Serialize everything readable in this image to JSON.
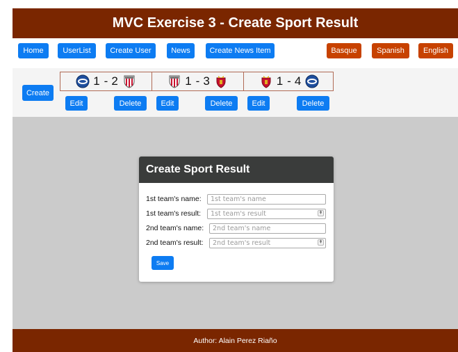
{
  "header": {
    "title": "MVC Exercise 3 - Create Sport Result"
  },
  "nav": {
    "left": [
      {
        "label": "Home"
      },
      {
        "label": "UserList"
      },
      {
        "label": "Create User"
      },
      {
        "label": "News"
      },
      {
        "label": "Create News Item"
      }
    ],
    "languages": [
      {
        "label": "Basque"
      },
      {
        "label": "Spanish"
      },
      {
        "label": "English"
      }
    ]
  },
  "results": {
    "create_label": "Create",
    "edit_label": "Edit",
    "delete_label": "Delete",
    "items": [
      {
        "team1_icon": "blue-crest-icon",
        "team1_result": "1",
        "separator": "-",
        "team2_result": "2",
        "team2_icon": "striped-crest-icon"
      },
      {
        "team1_icon": "striped-crest-icon",
        "team1_result": "1",
        "separator": "-",
        "team2_result": "3",
        "team2_icon": "red-crest-icon"
      },
      {
        "team1_icon": "red-crest-icon",
        "team1_result": "1",
        "separator": "-",
        "team2_result": "4",
        "team2_icon": "blue-crest-icon"
      }
    ]
  },
  "form": {
    "title": "Create Sport Result",
    "fields": [
      {
        "label": "1st team's name:",
        "placeholder": "1st team's name"
      },
      {
        "label": "1st team's result:",
        "placeholder": "1st team's result"
      },
      {
        "label": "2nd team's name:",
        "placeholder": "2nd team's name"
      },
      {
        "label": "2nd team's result:",
        "placeholder": "2nd team's result"
      }
    ],
    "save_label": "Save"
  },
  "footer": {
    "text": "Author: Alain Perez Riaño"
  },
  "colors": {
    "header_bg": "#7a2600",
    "nav_button": "#0d7cf2",
    "language_button": "#c74200",
    "card_header": "#3a3c3b",
    "page_bg": "#cbcbcb"
  }
}
